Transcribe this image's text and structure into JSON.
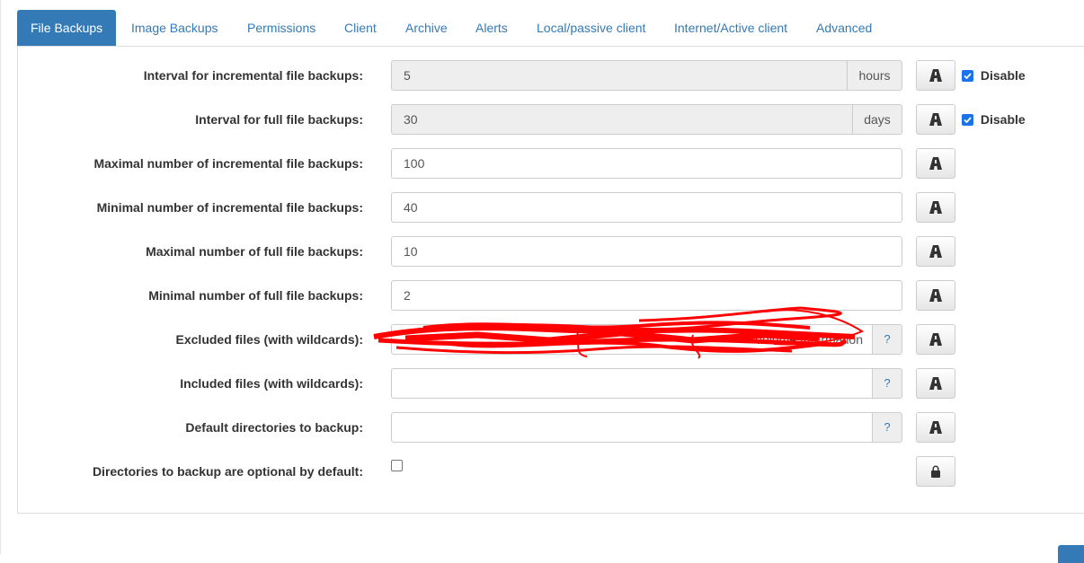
{
  "tabs": [
    {
      "label": "File Backups",
      "active": true
    },
    {
      "label": "Image Backups"
    },
    {
      "label": "Permissions"
    },
    {
      "label": "Client"
    },
    {
      "label": "Archive"
    },
    {
      "label": "Alerts"
    },
    {
      "label": "Local/passive client"
    },
    {
      "label": "Internet/Active client"
    },
    {
      "label": "Advanced"
    }
  ],
  "settings": {
    "incr_interval": {
      "label": "Interval for incremental file backups:",
      "value": "5",
      "unit": "hours",
      "disable_label": "Disable",
      "disabled": true
    },
    "full_interval": {
      "label": "Interval for full file backups:",
      "value": "30",
      "unit": "days",
      "disable_label": "Disable",
      "disabled": true
    },
    "max_incr": {
      "label": "Maximal number of incremental file backups:",
      "value": "100"
    },
    "min_incr": {
      "label": "Minimal number of incremental file backups:",
      "value": "40"
    },
    "max_full": {
      "label": "Maximal number of full file backups:",
      "value": "10"
    },
    "min_full": {
      "label": "Minimal number of full file backups:",
      "value": "2"
    },
    "excluded": {
      "label": "Excluded files (with wildcards):",
      "value": "Volume Information",
      "help": "?"
    },
    "included": {
      "label": "Included files (with wildcards):",
      "value": "",
      "help": "?"
    },
    "default_dirs": {
      "label": "Default directories to backup:",
      "value": "",
      "help": "?"
    },
    "dirs_optional": {
      "label": "Directories to backup are optional by default:",
      "checked": false
    }
  },
  "colors": {
    "accent": "#337ab7",
    "checkbox": "#1a73e8",
    "scribble": "#ff0000"
  },
  "icons": {
    "lock_toggle": "road-icon",
    "locked": "lock-icon"
  }
}
